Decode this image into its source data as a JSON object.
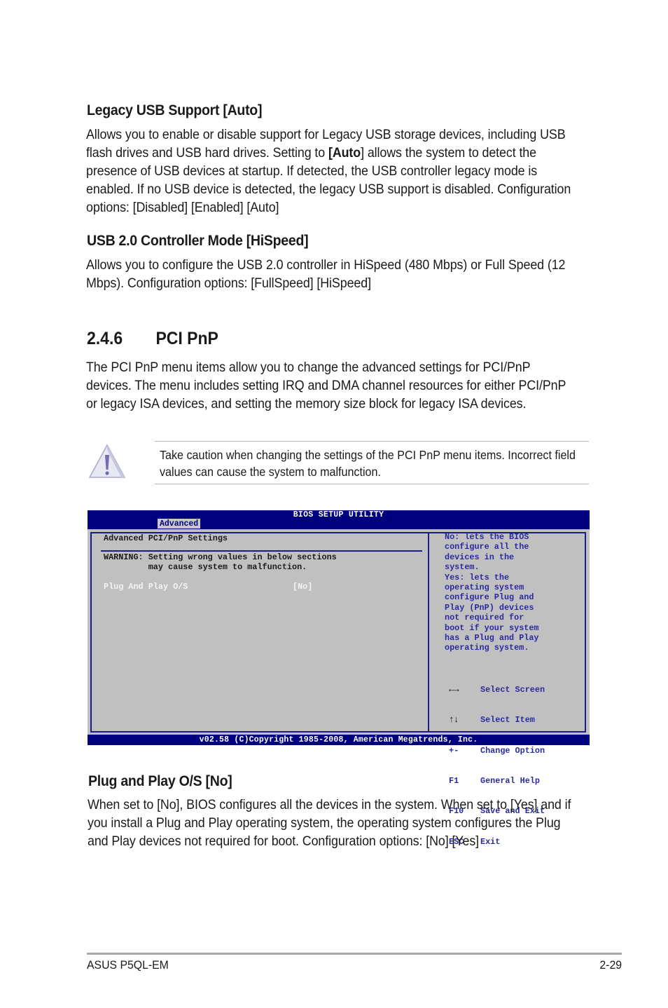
{
  "sections": {
    "legacy_usb": {
      "heading": "Legacy USB Support [Auto]",
      "text_before": "Allows you to enable or disable support for Legacy USB storage devices, including USB flash drives and USB hard drives. Setting to ",
      "text_bold": "[Auto",
      "text_after": "] allows the system to detect the presence of USB devices at startup. If detected, the USB controller legacy mode is enabled. If no USB device is detected, the legacy USB support is disabled. Configuration options: [Disabled] [Enabled] [Auto]"
    },
    "usb_controller": {
      "heading": "USB 2.0 Controller Mode [HiSpeed]",
      "text": "Allows you to configure the USB 2.0 controller in HiSpeed (480 Mbps) or Full Speed (12 Mbps). Configuration options: [FullSpeed] [HiSpeed]"
    },
    "pci_pnp": {
      "number": "2.4.6",
      "title": "PCI PnP",
      "text": "The PCI PnP menu items allow you to change the advanced settings for PCI/PnP devices. The menu includes setting IRQ and DMA channel resources for either PCI/PnP or legacy ISA devices, and setting the memory size block for legacy ISA devices."
    },
    "caution": {
      "icon": "warning-triangle-icon",
      "text": "Take caution when changing the settings of the PCI PnP menu items. Incorrect field values can cause the system to malfunction."
    },
    "plug_and_play": {
      "heading": "Plug and Play O/S [No]",
      "text": "When set to [No], BIOS configures all the devices in the system. When set to [Yes] and if you install a Plug and Play operating system, the operating system configures the Plug and Play devices not required for boot. Configuration options: [No] [Yes]"
    }
  },
  "bios": {
    "title": "BIOS SETUP UTILITY",
    "active_tab": "Advanced",
    "panel_title": "Advanced PCI/PnP Settings",
    "warning": "WARNING: Setting wrong values in below sections\n         may cause system to malfunction.",
    "items": [
      {
        "label": "Plug And Play O/S",
        "value": "[No]"
      }
    ],
    "help_text": "No: lets the BIOS\nconfigure all the\ndevices in the\nsystem.\nYes: lets the\noperating system\nconfigure Plug and\nPlay (PnP) devices\nnot required for\nboot if your system\nhas a Plug and Play\noperating system.",
    "keys": [
      {
        "key": "←→",
        "action": "Select Screen"
      },
      {
        "key": "↑↓",
        "action": "Select Item"
      },
      {
        "key": "+-",
        "action": "Change Option"
      },
      {
        "key": "F1",
        "action": "General Help"
      },
      {
        "key": "F10",
        "action": "Save and Exit"
      },
      {
        "key": "ESC",
        "action": "Exit"
      }
    ],
    "copyright": "v02.58 (C)Copyright 1985-2008, American Megatrends, Inc.",
    "colors": {
      "bar": "#00007e",
      "panel": "#c0c0c0",
      "help_text": "#2a2aa0",
      "item_text": "#f4f4f4"
    }
  },
  "footer": {
    "product": "ASUS P5QL-EM",
    "page": "2-29"
  }
}
